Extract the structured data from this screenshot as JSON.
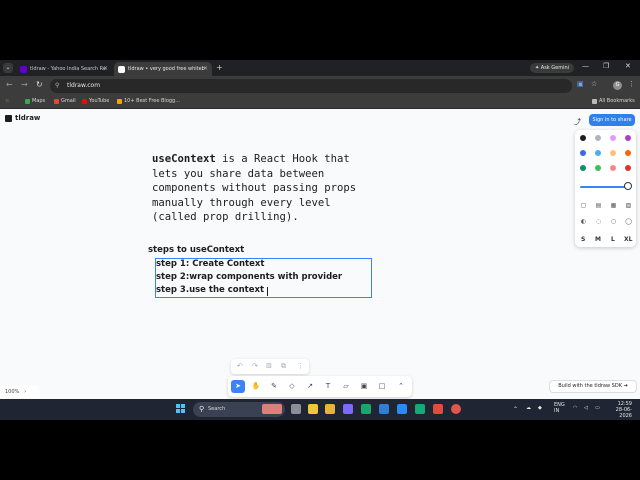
{
  "browser": {
    "tabs": [
      {
        "title": "tldraw - Yahoo India Search Re",
        "favicon_color": "#6001d2"
      },
      {
        "title": "tldraw • very good free whiteb",
        "favicon_color": "#ffffff"
      }
    ],
    "tab_list_icon": "chevron-down-icon",
    "new_tab": "+",
    "gemini_label": "Ask Gemini",
    "window_controls": [
      "—",
      "❐",
      "✕"
    ],
    "url": "tldraw.com",
    "nav_icons": [
      "←",
      "→",
      "C"
    ],
    "profile_initial": "G",
    "bookmarks": [
      {
        "label": "Maps",
        "color": "#34a853"
      },
      {
        "label": "Gmail",
        "color": "#ea4335"
      },
      {
        "label": "YouTube",
        "color": "#ff0000"
      },
      {
        "label": "10+ Best Free Blogg...",
        "color": "#f4a300"
      }
    ],
    "all_bookmarks": "All Bookmarks"
  },
  "tldraw": {
    "logo": "tldraw",
    "sign_in": "Sign in to share",
    "main_text": {
      "keyword": "useContext",
      "lines": [
        " is a React Hook that",
        "lets you share data between",
        "components without passing props",
        "manually through every level",
        "(called prop drilling)."
      ]
    },
    "steps_title": "steps to useContext",
    "steps": [
      "step 1: Create Context",
      "step 2:wrap components with provider",
      "step 3.use the context"
    ],
    "palette": [
      "#1d1d1d",
      "#adb5bd",
      "#e599f7",
      "#ae3ec9",
      "#4263eb",
      "#4dabf7",
      "#ffc078",
      "#f76707",
      "#099268",
      "#40c057",
      "#ff8787",
      "#e03131"
    ],
    "accent": "#3b82f6",
    "sizes": [
      "S",
      "M",
      "L",
      "XL"
    ],
    "selected_size": "M",
    "zoom": "100%",
    "sdk_label": "Build with the tldraw SDK",
    "edit_icons": [
      "↶",
      "↷",
      "🗑",
      "⧉",
      "⋮"
    ],
    "tool_icons": [
      "select-icon",
      "hand-icon",
      "draw-icon",
      "eraser-icon",
      "arrow-icon",
      "text-icon",
      "note-icon",
      "image-icon",
      "rectangle-icon",
      "more-icon"
    ]
  },
  "taskbar": {
    "search_placeholder": "Search",
    "language": "ENG",
    "region": "IN",
    "time": "12:59",
    "date": "28-06-2026"
  }
}
